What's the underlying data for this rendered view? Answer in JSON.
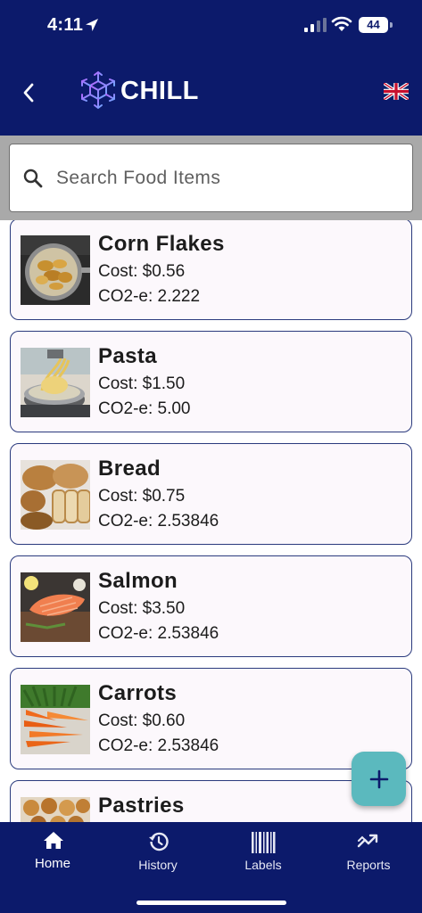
{
  "status_bar": {
    "time": "4:11",
    "battery": "44"
  },
  "header": {
    "app_name": "CHILL",
    "back_icon": "chevron-left-icon",
    "logo_icon": "snowflake-cube-icon",
    "language_icon": "uk-flag-icon"
  },
  "search": {
    "placeholder": "Search Food Items",
    "value": ""
  },
  "food_items": [
    {
      "name": "Corn Flakes",
      "cost": "Cost: $0.56",
      "co2": "CO2-e: 2.222"
    },
    {
      "name": "Pasta",
      "cost": "Cost: $1.50",
      "co2": "CO2-e: 5.00"
    },
    {
      "name": "Bread",
      "cost": "Cost: $0.75",
      "co2": "CO2-e: 2.53846"
    },
    {
      "name": "Salmon",
      "cost": "Cost: $3.50",
      "co2": "CO2-e: 2.53846"
    },
    {
      "name": "Carrots",
      "cost": "Cost: $0.60",
      "co2": "CO2-e: 2.53846"
    },
    {
      "name": "Pastries",
      "cost": "",
      "co2": ""
    }
  ],
  "fab": {
    "icon": "plus-icon"
  },
  "bottom_nav": {
    "items": [
      {
        "label": "Home",
        "icon": "home-icon",
        "active": true
      },
      {
        "label": "History",
        "icon": "history-icon",
        "active": false
      },
      {
        "label": "Labels",
        "icon": "barcode-icon",
        "active": false
      },
      {
        "label": "Reports",
        "icon": "trend-icon",
        "active": false
      }
    ]
  },
  "colors": {
    "navy": "#0c1a6b",
    "fab_teal": "#5bb9be",
    "card_border": "#2a3a7d",
    "card_bg": "#fcf8fc",
    "search_band": "#a9a9a9"
  }
}
